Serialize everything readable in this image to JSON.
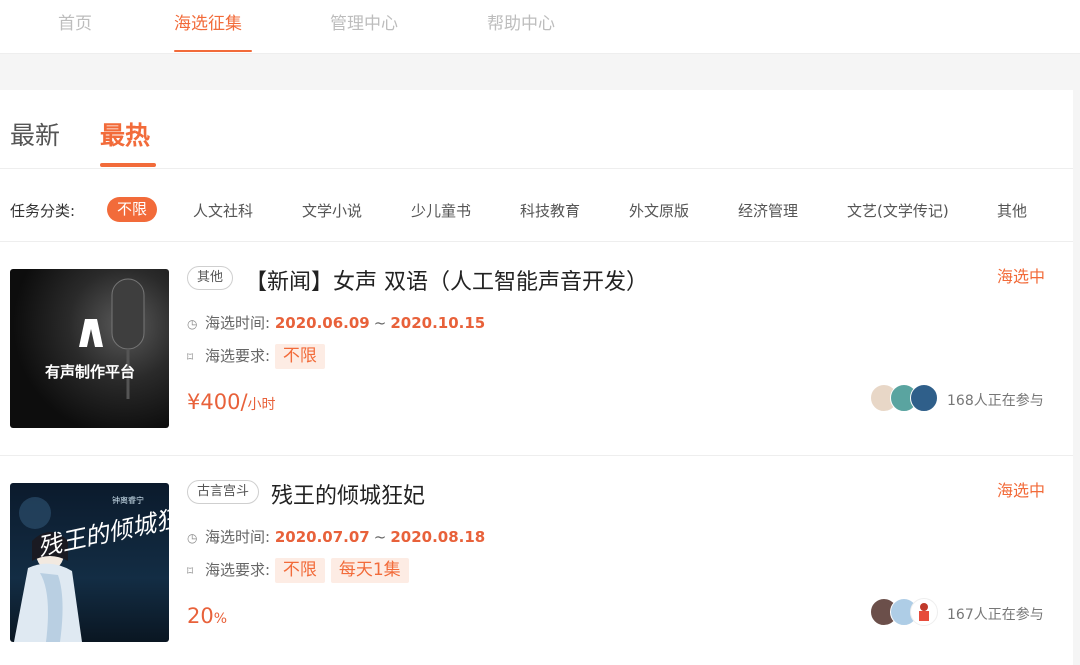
{
  "topnav": {
    "items": [
      "首页",
      "海选征集",
      "管理中心",
      "帮助中心"
    ]
  },
  "sort_tabs": [
    "最新",
    "最热"
  ],
  "filter": {
    "label": "任务分类:",
    "categories": [
      "不限",
      "人文社科",
      "文学小说",
      "少儿童书",
      "科技教育",
      "外文原版",
      "经济管理",
      "文艺(文学传记)",
      "其他"
    ]
  },
  "cards": [
    {
      "tag": "其他",
      "title": "【新闻】女声 双语（人工智能声音开发）",
      "status": "海选中",
      "time_label": "海选时间:",
      "start": "2020.06.09",
      "tilde": "~",
      "end": "2020.10.15",
      "req_label": "海选要求:",
      "reqs": [
        "不限"
      ],
      "price_big": "¥400/",
      "price_small": "小时",
      "joined": "168人正在参与",
      "cover_text": "有声制作平台"
    },
    {
      "tag": "古言宫斗",
      "title": "残王的倾城狂妃",
      "status": "海选中",
      "time_label": "海选时间:",
      "start": "2020.07.07",
      "tilde": "~",
      "end": "2020.08.18",
      "req_label": "海选要求:",
      "reqs": [
        "不限",
        "每天1集"
      ],
      "price_big": "20",
      "price_small": "%",
      "joined": "167人正在参与",
      "cover_text": "残王的倾城狂妃",
      "cover_subtext": "钟离睿宁"
    }
  ]
}
